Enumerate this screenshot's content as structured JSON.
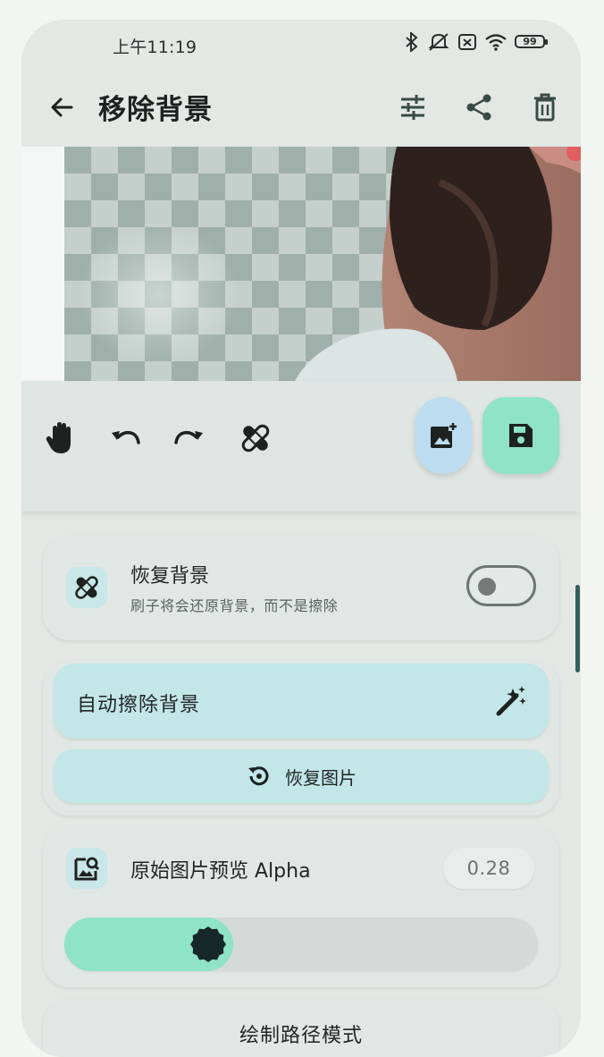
{
  "status_bar": {
    "time": "上午11:19",
    "battery": "99",
    "icons": [
      "bluetooth-icon",
      "mute-icon",
      "sim-off-icon",
      "wifi-icon",
      "battery-icon"
    ]
  },
  "app_bar": {
    "title": "移除背景",
    "actions": [
      "tune-icon",
      "share-icon",
      "delete-icon"
    ]
  },
  "toolbar": {
    "tools": [
      "pan-hand-icon",
      "undo-icon",
      "redo-icon",
      "restore-brush-icon"
    ],
    "fabs": [
      "add-image-icon",
      "save-icon"
    ]
  },
  "restore_card": {
    "title": "恢复背景",
    "subtitle": "刷子将会还原背景，而不是擦除",
    "toggle_on": false
  },
  "auto_card": {
    "auto_erase_label": "自动擦除背景",
    "restore_image_label": "恢复图片"
  },
  "alpha_card": {
    "title": "原始图片预览 Alpha",
    "value": "0.28",
    "slider_value": 0.28
  },
  "draw_mode_card": {
    "title": "绘制路径模式"
  },
  "colors": {
    "accent_mint": "#8fe3c6",
    "tile_cyan": "#c3e6e8",
    "fab_blue": "#bcdcef",
    "surface": "#e1e7e4"
  }
}
